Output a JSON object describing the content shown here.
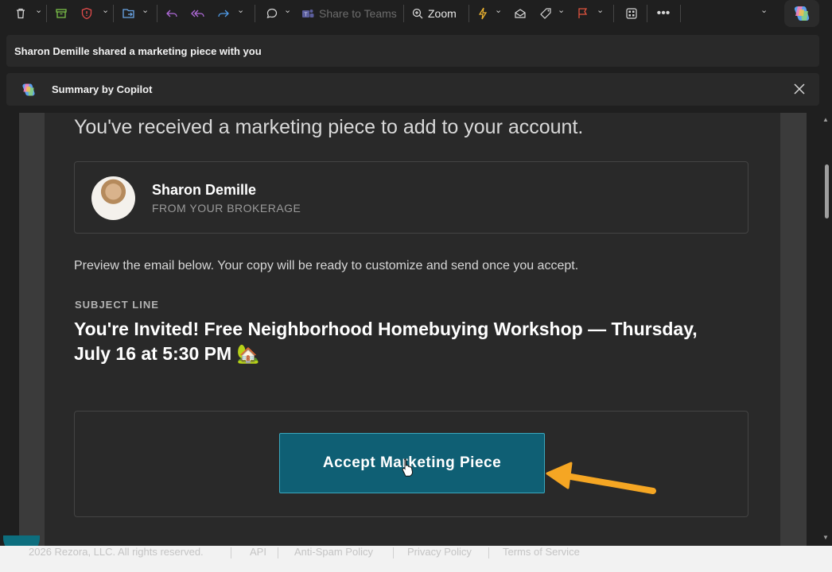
{
  "toolbar": {
    "share_to_teams": "Share to Teams",
    "zoom": "Zoom"
  },
  "notice": {
    "text": "Sharon Demille shared a marketing piece with you"
  },
  "copilot": {
    "title": "Summary by Copilot"
  },
  "email": {
    "headline": "You've received a marketing piece to add to your account.",
    "sender": {
      "name": "Sharon Demille",
      "subtitle": "FROM YOUR BROKERAGE"
    },
    "preview_text": "Preview the email below. Your copy will be ready to customize and send once you accept.",
    "subject_label": "SUBJECT LINE",
    "subject": "You're Invited! Free Neighborhood Homebuying Workshop — Thursday, July 16 at 5:30 PM 🏡",
    "accept_button": "Accept Marketing Piece"
  },
  "footer": {
    "copyright": "2026 Rezora, LLC. All rights reserved.",
    "links": [
      "API",
      "Anti-Spam Policy",
      "Privacy Policy",
      "Terms of Service"
    ]
  },
  "colors": {
    "accent_teal": "#0f5f74",
    "arrow": "#f5a623"
  }
}
